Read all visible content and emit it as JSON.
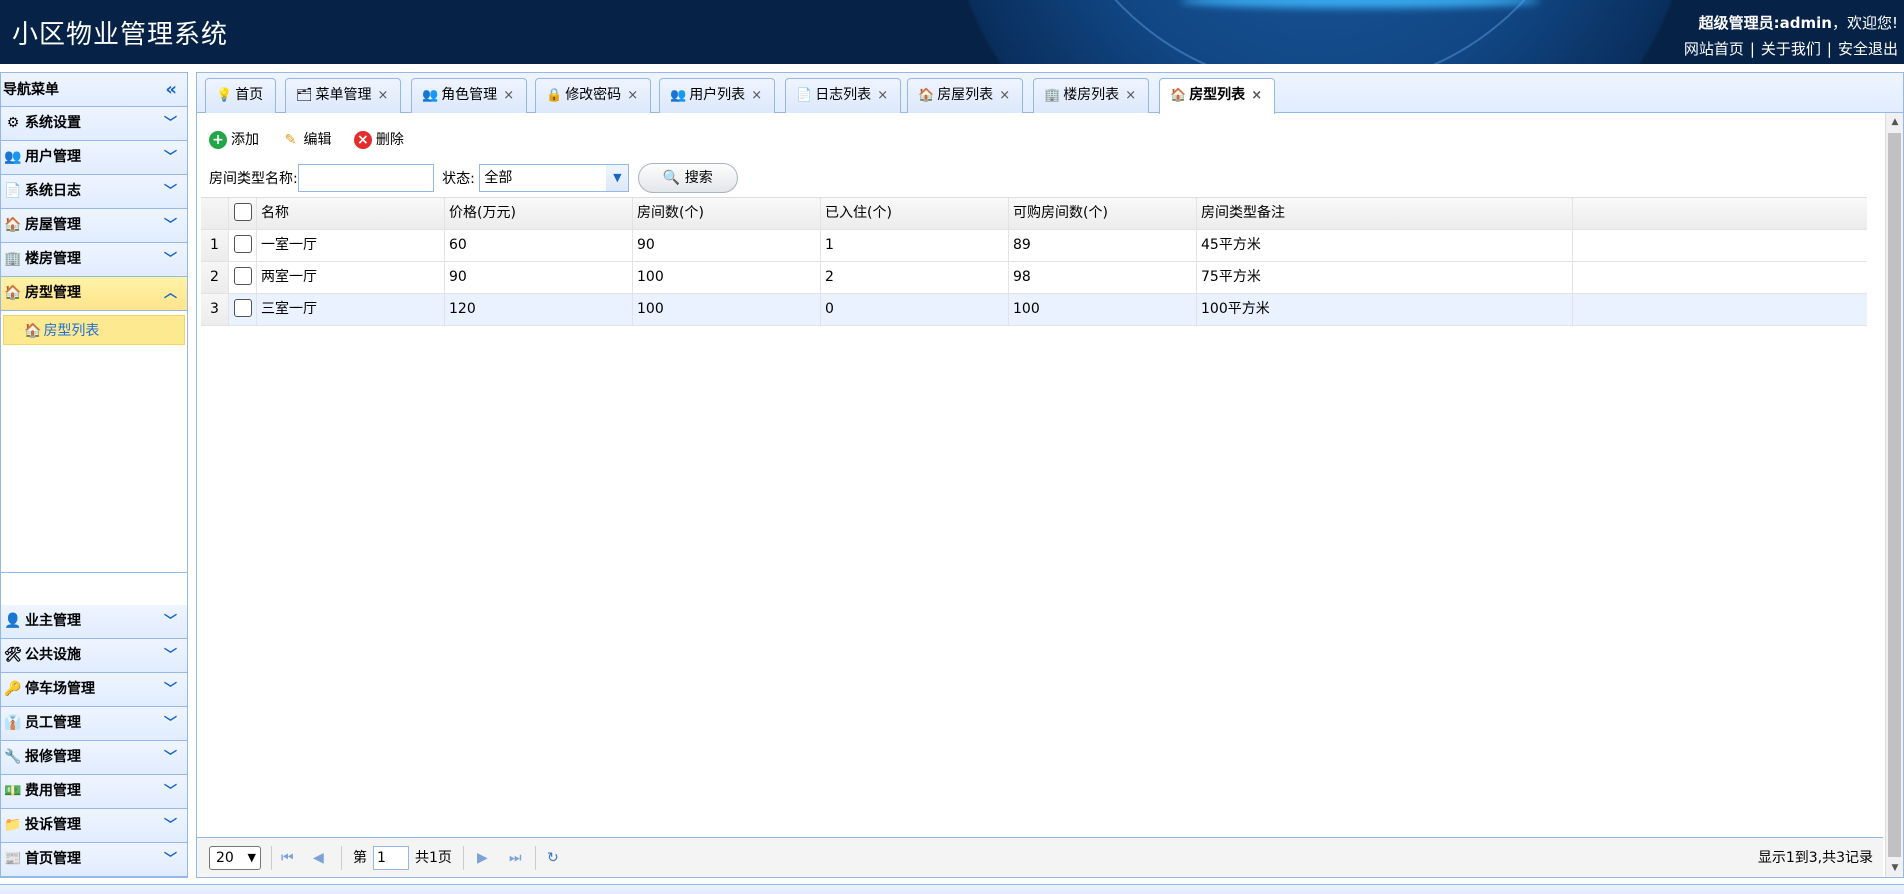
{
  "header": {
    "title": "小区物业管理系统",
    "welcome_user": "超级管理员:admin",
    "welcome_suffix": "，欢迎您!",
    "links": [
      "网站首页",
      "关于我们",
      "安全退出"
    ]
  },
  "sidebar": {
    "title": "导航菜单",
    "items_top": [
      {
        "label": "系统设置",
        "icon": "gear-icon"
      },
      {
        "label": "用户管理",
        "icon": "users-icon"
      },
      {
        "label": "系统日志",
        "icon": "log-icon"
      },
      {
        "label": "房屋管理",
        "icon": "house-icon"
      },
      {
        "label": "楼房管理",
        "icon": "building-icon"
      },
      {
        "label": "房型管理",
        "icon": "house-icon",
        "active": true
      }
    ],
    "submenu": [
      {
        "label": "房型列表",
        "icon": "house-icon"
      }
    ],
    "items_bottom": [
      {
        "label": "业主管理",
        "icon": "owner-icon"
      },
      {
        "label": "公共设施",
        "icon": "tools-icon"
      },
      {
        "label": "停车场管理",
        "icon": "key-icon"
      },
      {
        "label": "员工管理",
        "icon": "staff-icon"
      },
      {
        "label": "报修管理",
        "icon": "wrench-icon"
      },
      {
        "label": "费用管理",
        "icon": "money-icon"
      },
      {
        "label": "投诉管理",
        "icon": "folder-icon"
      },
      {
        "label": "首页管理",
        "icon": "page-icon"
      }
    ]
  },
  "tabs": [
    {
      "label": "首页",
      "icon": "bulb-icon",
      "closable": false
    },
    {
      "label": "菜单管理",
      "icon": "tree-icon",
      "closable": true
    },
    {
      "label": "角色管理",
      "icon": "users-icon",
      "closable": true
    },
    {
      "label": "修改密码",
      "icon": "lock-icon",
      "closable": true
    },
    {
      "label": "用户列表",
      "icon": "users-icon",
      "closable": true
    },
    {
      "label": "日志列表",
      "icon": "log-icon",
      "closable": true
    },
    {
      "label": "房屋列表",
      "icon": "house-icon",
      "closable": true
    },
    {
      "label": "楼房列表",
      "icon": "building-icon",
      "closable": true
    },
    {
      "label": "房型列表",
      "icon": "house-icon",
      "closable": true,
      "active": true
    }
  ],
  "toolbar": {
    "add": "添加",
    "edit": "编辑",
    "delete": "删除"
  },
  "search": {
    "name_label": "房间类型名称:",
    "name_value": "",
    "status_label": "状态:",
    "status_value": "全部",
    "button": "搜索"
  },
  "table": {
    "columns": [
      "名称",
      "价格(万元)",
      "房间数(个)",
      "已入住(个)",
      "可购房间数(个)",
      "房间类型备注"
    ],
    "rows": [
      [
        "一室一厅",
        "60",
        "90",
        "1",
        "89",
        "45平方米"
      ],
      [
        "两室一厅",
        "90",
        "100",
        "2",
        "98",
        "75平方米"
      ],
      [
        "三室一厅",
        "120",
        "100",
        "0",
        "100",
        "100平方米"
      ]
    ],
    "selected_row": 3
  },
  "pager": {
    "page_size": "20",
    "page_prefix": "第",
    "page_value": "1",
    "page_total": "共1页",
    "summary": "显示1到3,共3记录"
  },
  "colors": {
    "header_bg": "#062347",
    "border": "#95b8e7",
    "active_yellow": "#ffe48d",
    "link_blue": "#1f6fd6"
  }
}
